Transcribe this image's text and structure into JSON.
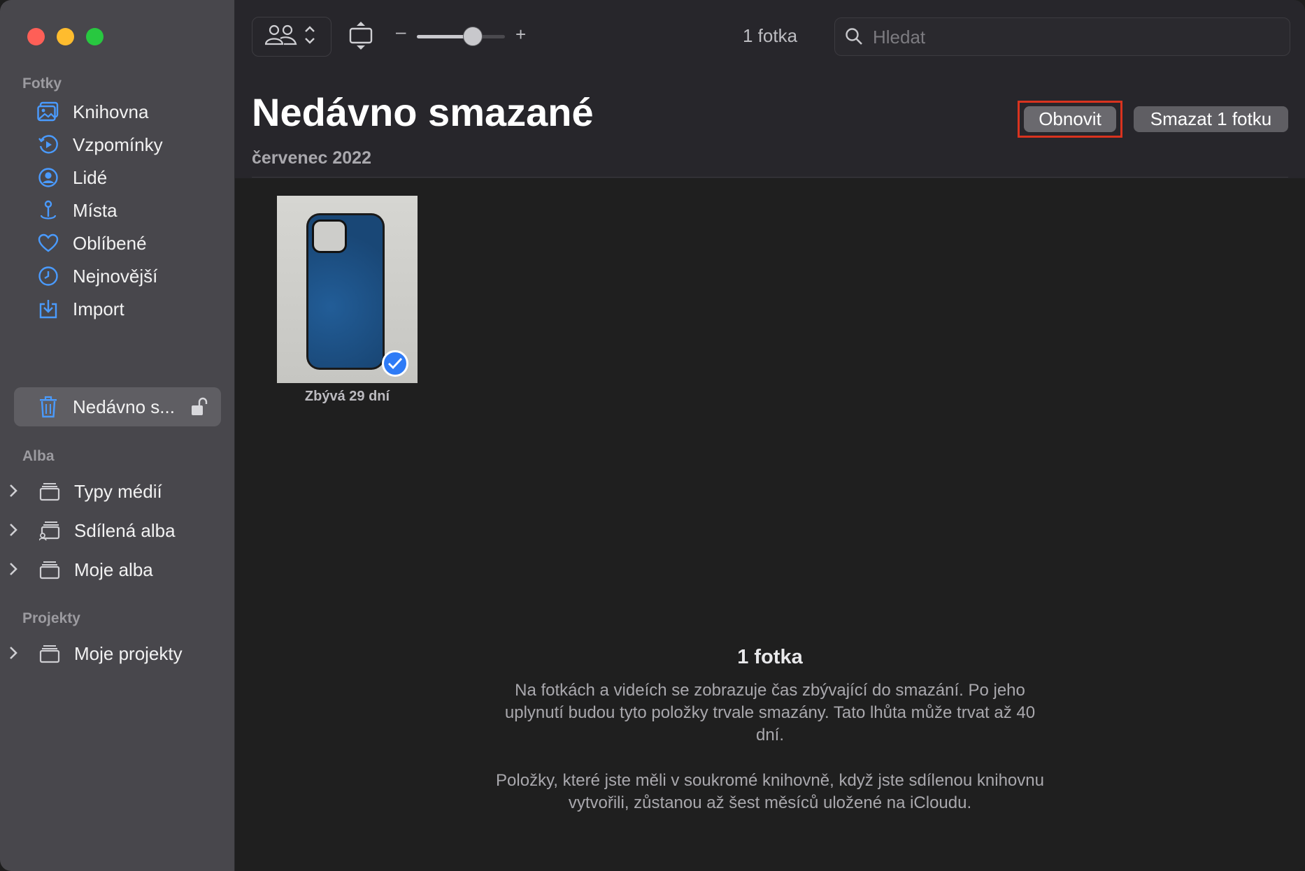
{
  "window": {
    "traffic_lights": [
      "close",
      "minimize",
      "zoom"
    ],
    "colors": {
      "close": "#fe5f57",
      "minimize": "#febc2e",
      "zoom": "#28c840",
      "accent": "#3b82f6",
      "highlight": "#d9331f"
    }
  },
  "sidebar": {
    "sections": [
      {
        "label": "Fotky",
        "items": [
          {
            "label": "Knihovna",
            "icon": "library-icon"
          },
          {
            "label": "Vzpomínky",
            "icon": "memories-icon"
          },
          {
            "label": "Lidé",
            "icon": "people-icon"
          },
          {
            "label": "Místa",
            "icon": "places-icon"
          },
          {
            "label": "Oblíbené",
            "icon": "heart-icon"
          },
          {
            "label": "Nejnovější",
            "icon": "clock-icon"
          },
          {
            "label": "Import",
            "icon": "import-icon"
          },
          {
            "label": "Nedávno s...",
            "icon": "trash-icon",
            "selected": true,
            "lock": "unlocked-icon"
          }
        ]
      },
      {
        "label": "Alba",
        "items": [
          {
            "label": "Typy médií",
            "icon": "album-stack-icon"
          },
          {
            "label": "Sdílená alba",
            "icon": "shared-album-icon"
          },
          {
            "label": "Moje alba",
            "icon": "album-stack-icon"
          }
        ]
      },
      {
        "label": "Projekty",
        "items": [
          {
            "label": "Moje projekty",
            "icon": "album-stack-icon"
          }
        ]
      }
    ]
  },
  "toolbar": {
    "zoom_minus": "–",
    "zoom_plus": "+",
    "zoom_level": 0.63,
    "photo_count": "1 fotka",
    "search": {
      "placeholder": "Hledat",
      "value": ""
    }
  },
  "main": {
    "title": "Nedávno smazané",
    "month": "červenec 2022",
    "recover_label": "Obnovit",
    "delete_label": "Smazat 1 fotku",
    "photo": {
      "caption": "Zbývá 29 dní",
      "selected": true
    },
    "info": {
      "title": "1 fotka",
      "paragraph1": "Na fotkách a videích se zobrazuje čas zbývající do smazání. Po jeho uplynutí budou tyto položky trvale smazány. Tato lhůta může trvat až 40 dní.",
      "paragraph2": "Položky, které jste měli v soukromé knihovně, když jste sdílenou knihovnu vytvořili, zůstanou až šest měsíců uložené na iCloudu."
    }
  }
}
